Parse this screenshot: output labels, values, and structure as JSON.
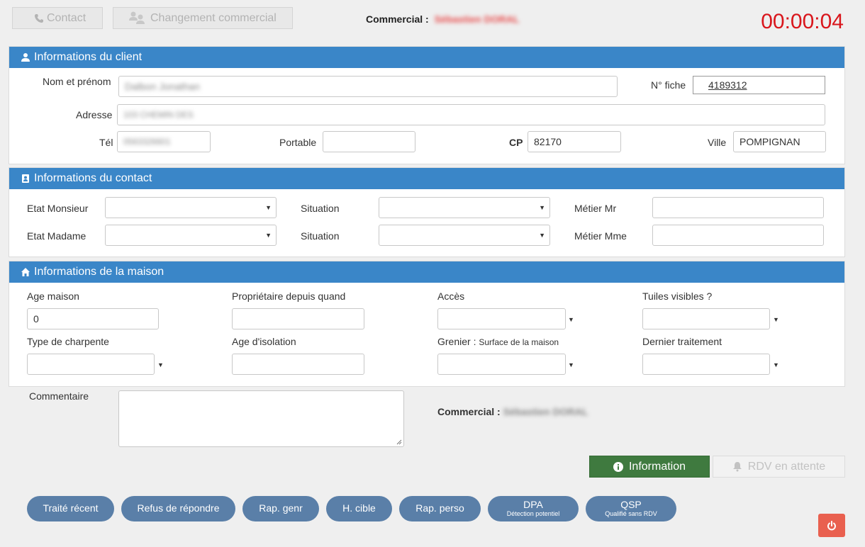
{
  "topbar": {
    "contact_label": "Contact",
    "change_label": "Changement commercial",
    "commercial_label": "Commercial :",
    "commercial_name": "Sébastien DORAL",
    "timer": "00:00:04"
  },
  "client": {
    "title": "Informations du client",
    "name_label": "Nom et prénom",
    "name_value": "Dalbon Jonathan",
    "fiche_label": "N° fiche",
    "fiche_value": "4189312",
    "address_label": "Adresse",
    "address_value": "103 CHEMIN DES",
    "tel_label": "Tél",
    "tel_value": "0563326601",
    "portable_label": "Portable",
    "portable_value": "",
    "cp_label": "CP",
    "cp_value": "82170",
    "ville_label": "Ville",
    "ville_value": "POMPIGNAN"
  },
  "contact": {
    "title": "Informations du contact",
    "etat_mr_label": "Etat Monsieur",
    "etat_mme_label": "Etat Madame",
    "situation_label": "Situation",
    "metier_mr_label": "Métier Mr",
    "metier_mme_label": "Métier Mme"
  },
  "maison": {
    "title": "Informations de la maison",
    "age_label": "Age maison",
    "age_value": "0",
    "proprietaire_label": "Propriétaire depuis quand",
    "acces_label": "Accès",
    "tuiles_label": "Tuiles visibles ?",
    "charpente_label": "Type de charpente",
    "isolation_label": "Age d'isolation",
    "grenier_label": "Grenier :",
    "grenier_sub": "Surface de la maison",
    "traitement_label": "Dernier traitement"
  },
  "bottom": {
    "commentaire_label": "Commentaire",
    "commercial_label": "Commercial :",
    "commercial_name": "Sébastien DORAL",
    "information_label": "Information",
    "rdv_label": "RDV en attente"
  },
  "pills": [
    {
      "label": "Traité récent",
      "sub": ""
    },
    {
      "label": "Refus de répondre",
      "sub": ""
    },
    {
      "label": "Rap. genr",
      "sub": ""
    },
    {
      "label": "H. cible",
      "sub": ""
    },
    {
      "label": "Rap. perso",
      "sub": ""
    },
    {
      "label": "DPA",
      "sub": "Détection potentiel"
    },
    {
      "label": "QSP",
      "sub": "Qualifié sans RDV"
    }
  ],
  "colors": {
    "panel_header": "#3a86c8",
    "timer": "#d9161c",
    "information_button": "#3f7a3f",
    "pill": "#5a7fa8",
    "power_button": "#e9604f"
  }
}
